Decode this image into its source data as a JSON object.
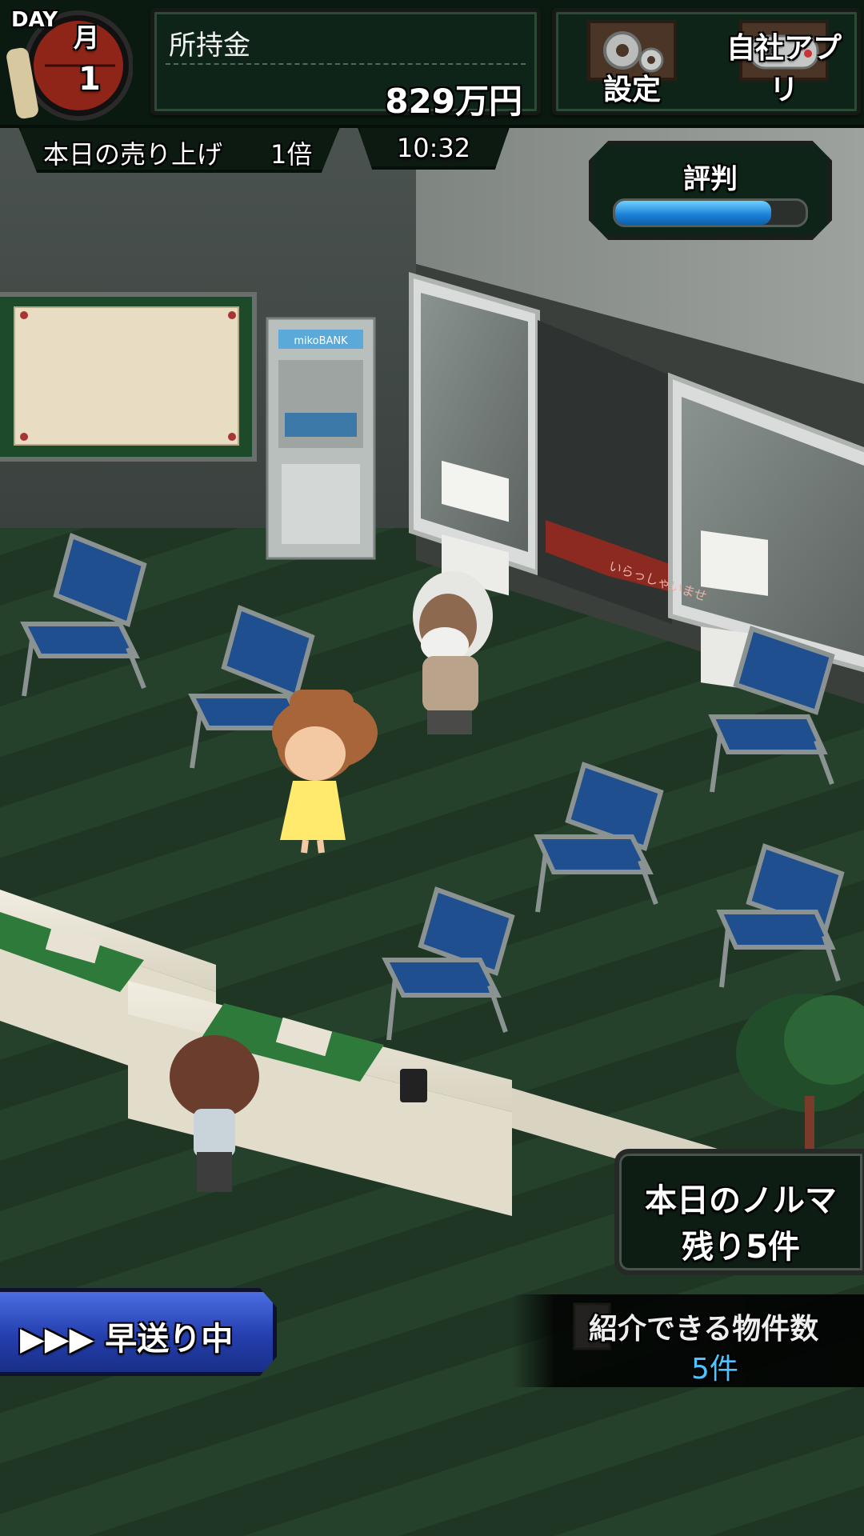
{
  "hud": {
    "day": {
      "label": "DAY",
      "weekday": "月",
      "number": "1"
    },
    "money": {
      "label": "所持金",
      "value": "829万円"
    },
    "menu": {
      "settings_label": "設定",
      "apps_label": "自社アプリ"
    },
    "sales": {
      "label": "本日の売り上げ",
      "value": "1倍"
    },
    "time": "10:32",
    "reputation": {
      "label": "評判",
      "level": 0.82
    },
    "quota": {
      "title": "本日のノルマ",
      "remaining": "残り5件"
    },
    "fast_forward": {
      "label": "▶▶▶ 早送り中"
    },
    "listings": {
      "label": "紹介できる物件数",
      "value": "5件"
    }
  },
  "scene": {
    "atm_sign": "mikoBANK",
    "door_mat_text": "いらっしゃいませ"
  },
  "colors": {
    "floor": "#243a28",
    "wall": "#3d4340",
    "chair_seat": "#1f4f8f",
    "rep_bar": "#1a7fd6",
    "listings_count": "#4fc3ff"
  }
}
